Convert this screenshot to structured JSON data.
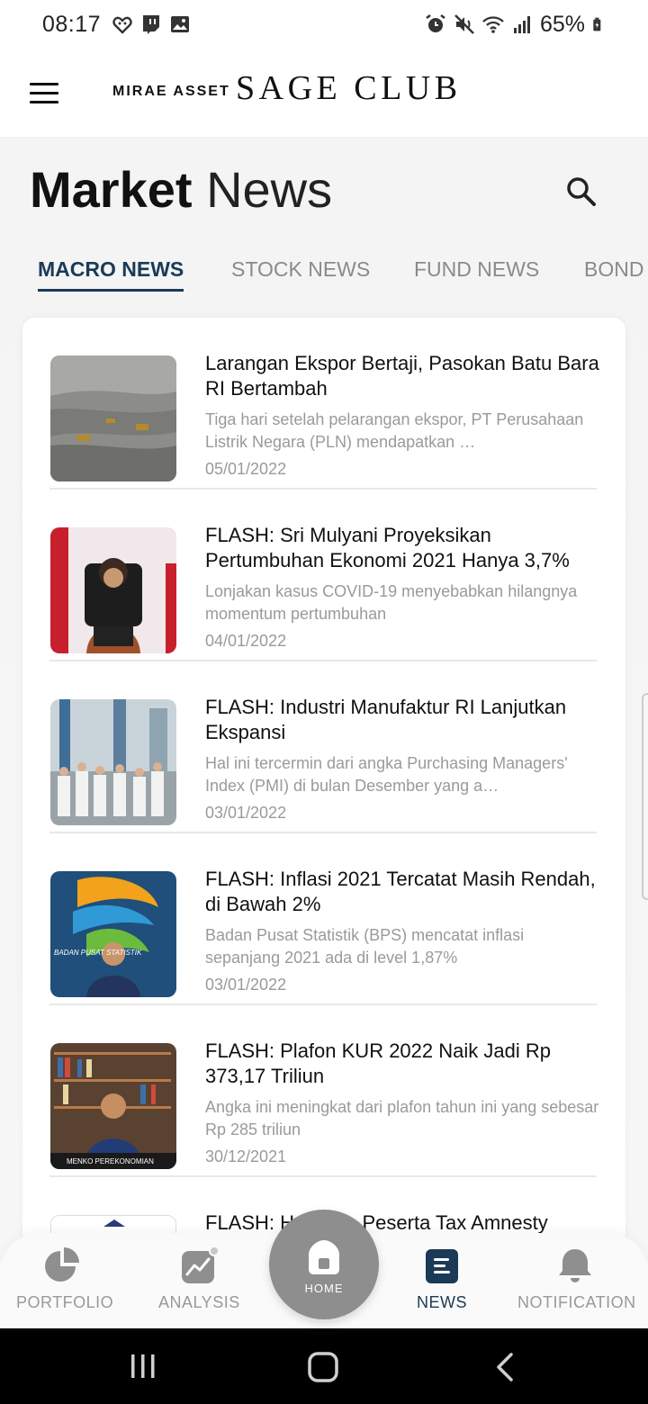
{
  "status_bar": {
    "time": "08:17",
    "battery": "65%",
    "icons": [
      "heart-chat-icon",
      "twitch-icon",
      "gallery-icon",
      "alarm-icon",
      "mute-icon",
      "wifi-icon",
      "signal-icon",
      "battery-charging-icon"
    ]
  },
  "header": {
    "brand_small": "MIRAE ASSET",
    "brand_big": "SAGE CLUB",
    "menu_icon": "hamburger-icon"
  },
  "page": {
    "title_bold": "Market",
    "title_light": "News",
    "search_icon": "search-icon"
  },
  "tabs": [
    {
      "label": "MACRO NEWS",
      "active": true
    },
    {
      "label": "STOCK NEWS",
      "active": false
    },
    {
      "label": "FUND NEWS",
      "active": false
    },
    {
      "label": "BOND",
      "active": false
    }
  ],
  "news": [
    {
      "title": "Larangan Ekspor Bertaji, Pasokan Batu Bara RI Bertambah",
      "summary": "Tiga hari setelah pelarangan ekspor, PT Perusahaan Listrik Negara (PLN) mendapatkan …",
      "date": "05/01/2022"
    },
    {
      "title": "FLASH: Sri Mulyani Proyeksikan Pertumbuhan Ekonomi 2021 Hanya 3,7%",
      "summary": "Lonjakan kasus COVID-19 menyebabkan hilangnya momentum pertumbuhan",
      "date": "04/01/2022"
    },
    {
      "title": "FLASH: Industri Manufaktur RI Lanjutkan Ekspansi",
      "summary": "Hal ini tercermin dari angka Purchasing Managers' Index (PMI) di bulan Desember yang a…",
      "date": "03/01/2022"
    },
    {
      "title": "FLASH: Inflasi 2021 Tercatat Masih Rendah, di Bawah 2%",
      "summary": "Badan Pusat Statistik (BPS) mencatat inflasi sepanjang 2021 ada di level 1,87%",
      "date": "03/01/2022",
      "thumb_text": "BADAN PUSAT STATISTIK"
    },
    {
      "title": "FLASH: Plafon KUR 2022 Naik Jadi Rp 373,17 Triliun",
      "summary": "Angka ini meningkat dari plafon tahun ini yang sebesar Rp 285 triliun",
      "date": "30/12/2021",
      "thumb_text": "MENKO PEREKONOMIAN"
    },
    {
      "title": "FLASH: H",
      "title_tail": "lon Peserta Tax Amnesty"
    }
  ],
  "bottom_nav": {
    "portfolio": "PORTFOLIO",
    "analysis": "ANALYSIS",
    "home": "HOME",
    "news": "NEWS",
    "notification": "NOTIFICATION"
  },
  "colors": {
    "accent": "#1b3a57",
    "inactive": "#999999",
    "home_button": "#8e8e8e"
  }
}
